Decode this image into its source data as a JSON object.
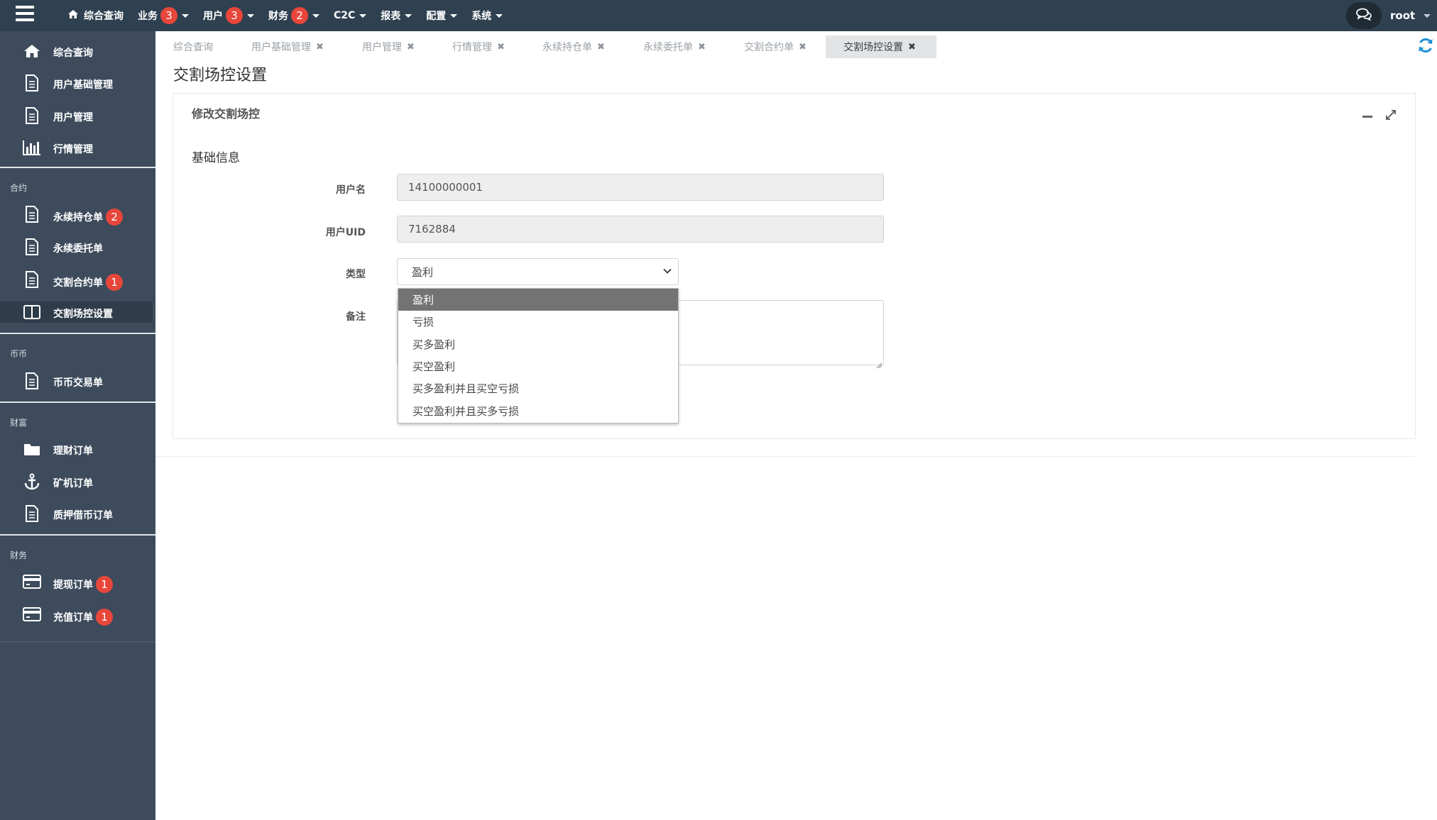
{
  "topbar": {
    "nav": [
      {
        "label": "综合查询",
        "badge": null,
        "caret": false
      },
      {
        "label": "业务",
        "badge": "3",
        "caret": true
      },
      {
        "label": "用户",
        "badge": "3",
        "caret": true
      },
      {
        "label": "财务",
        "badge": "2",
        "caret": true
      },
      {
        "label": "C2C",
        "badge": null,
        "caret": true
      },
      {
        "label": "报表",
        "badge": null,
        "caret": true
      },
      {
        "label": "配置",
        "badge": null,
        "caret": true
      },
      {
        "label": "系统",
        "badge": null,
        "caret": true
      }
    ],
    "user": "root"
  },
  "sidebar": {
    "items": [
      {
        "label": "综合查询",
        "icon": "home-icon"
      },
      {
        "label": "用户基础管理",
        "icon": "document-icon"
      },
      {
        "label": "用户管理",
        "icon": "document-icon"
      },
      {
        "label": "行情管理",
        "icon": "bar-chart-icon"
      },
      {
        "label": "永续持仓单",
        "icon": "document-icon",
        "badge": "2"
      },
      {
        "label": "永续委托单",
        "icon": "document-icon"
      },
      {
        "label": "交割合约单",
        "icon": "document-icon",
        "badge": "1"
      },
      {
        "label": "交割场控设置",
        "icon": "columns-icon"
      },
      {
        "label": "币币交易单",
        "icon": "document-icon"
      },
      {
        "label": "理财订单",
        "icon": "folder-icon"
      },
      {
        "label": "矿机订单",
        "icon": "anchor-icon"
      },
      {
        "label": "质押借币订单",
        "icon": "document-icon"
      },
      {
        "label": "提现订单",
        "icon": "credit-card-icon",
        "badge": "1"
      },
      {
        "label": "充值订单",
        "icon": "credit-card-icon",
        "badge": "1"
      }
    ],
    "sections": [
      "合约",
      "币币",
      "财富",
      "财务"
    ]
  },
  "tabs": [
    {
      "label": "综合查询"
    },
    {
      "label": "用户基础管理"
    },
    {
      "label": "用户管理"
    },
    {
      "label": "行情管理"
    },
    {
      "label": "永续持仓单"
    },
    {
      "label": "永续委托单"
    },
    {
      "label": "交割合约单"
    },
    {
      "label": "交割场控设置"
    }
  ],
  "page": {
    "title": "交割场控设置",
    "panel_title": "修改交割场控",
    "section_title": "基础信息"
  },
  "form": {
    "username_label": "用户名",
    "username_value": "14100000001",
    "uid_label": "用户UID",
    "uid_value": "7162884",
    "type_label": "类型",
    "type_value": "盈利",
    "remark_label": "备注"
  },
  "dropdown": {
    "options": [
      "盈利",
      "亏损",
      "买多盈利",
      "买空盈利",
      "买多盈利并且买空亏损",
      "买空盈利并且买多亏损"
    ],
    "selected": "盈利"
  },
  "colors": {
    "topbar": "#2f4050",
    "sidebar": "#3d4b5c",
    "badge": "#e8463b",
    "refresh": "#1b8fd6"
  }
}
